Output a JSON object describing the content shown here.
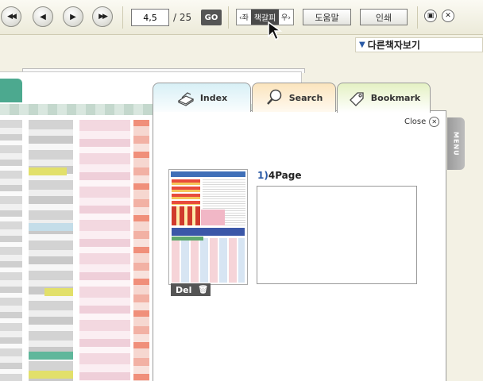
{
  "toolbar": {
    "first_icon": "double-left-arrow-icon",
    "prev_icon": "left-arrow-icon",
    "next_icon": "right-arrow-icon",
    "last_icon": "double-right-arrow-icon",
    "page_value": "4,5",
    "page_total": "/ 25",
    "go_label": "GO",
    "bookmark_prev": "‹좌",
    "bookmark_label": "책갈피",
    "bookmark_next": "우›",
    "help_label": "도움말",
    "print_label": "인쇄",
    "minimize_icon": "minimize-icon",
    "close_icon": "close-icon"
  },
  "other_books": {
    "label": "다른책자보기",
    "icon": "triangle-down-icon"
  },
  "panel": {
    "tabs": [
      {
        "label": "Index",
        "icon": "book-icon"
      },
      {
        "label": "Search",
        "icon": "magnifier-icon"
      },
      {
        "label": "Bookmark",
        "icon": "bookmark-tag-icon",
        "active": true
      }
    ],
    "close_label": "Close",
    "menu_label": "MENU",
    "bookmark_item": {
      "index": "1)",
      "title": "4Page",
      "del_label": "Del",
      "trash_icon": "trash-icon",
      "memo": ""
    }
  },
  "colors": {
    "accent_blue": "#2a5aa6",
    "tab_index": "#d8f0f6",
    "tab_search": "#fbe4bd",
    "tab_bookmark": "#e4f1c3",
    "dark_button": "#555555"
  }
}
